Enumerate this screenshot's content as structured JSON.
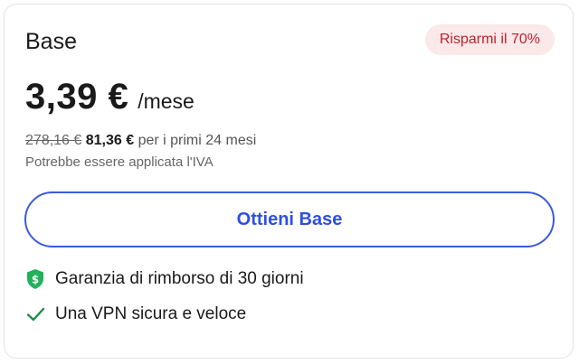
{
  "plan": {
    "name": "Base",
    "badge": "Risparmi il 70%",
    "price": "3,39 €",
    "period": "/mese",
    "old_total": "278,16 €",
    "new_total": "81,36 €",
    "billing_term": "per i primi 24 mesi",
    "vat_note": "Potrebbe essere applicata l'IVA",
    "cta_label": "Ottieni Base"
  },
  "features": [
    {
      "icon": "shield-dollar-icon",
      "label": "Garanzia di rimborso di 30 giorni"
    },
    {
      "icon": "checkmark-icon",
      "label": "Una VPN sicura e veloce"
    }
  ],
  "colors": {
    "accent": "#3b5bdb",
    "badge_bg": "#fbe9e9",
    "badge_text": "#c21f2e",
    "shield_green": "#1fb25a",
    "check_green": "#1e8a4a"
  }
}
